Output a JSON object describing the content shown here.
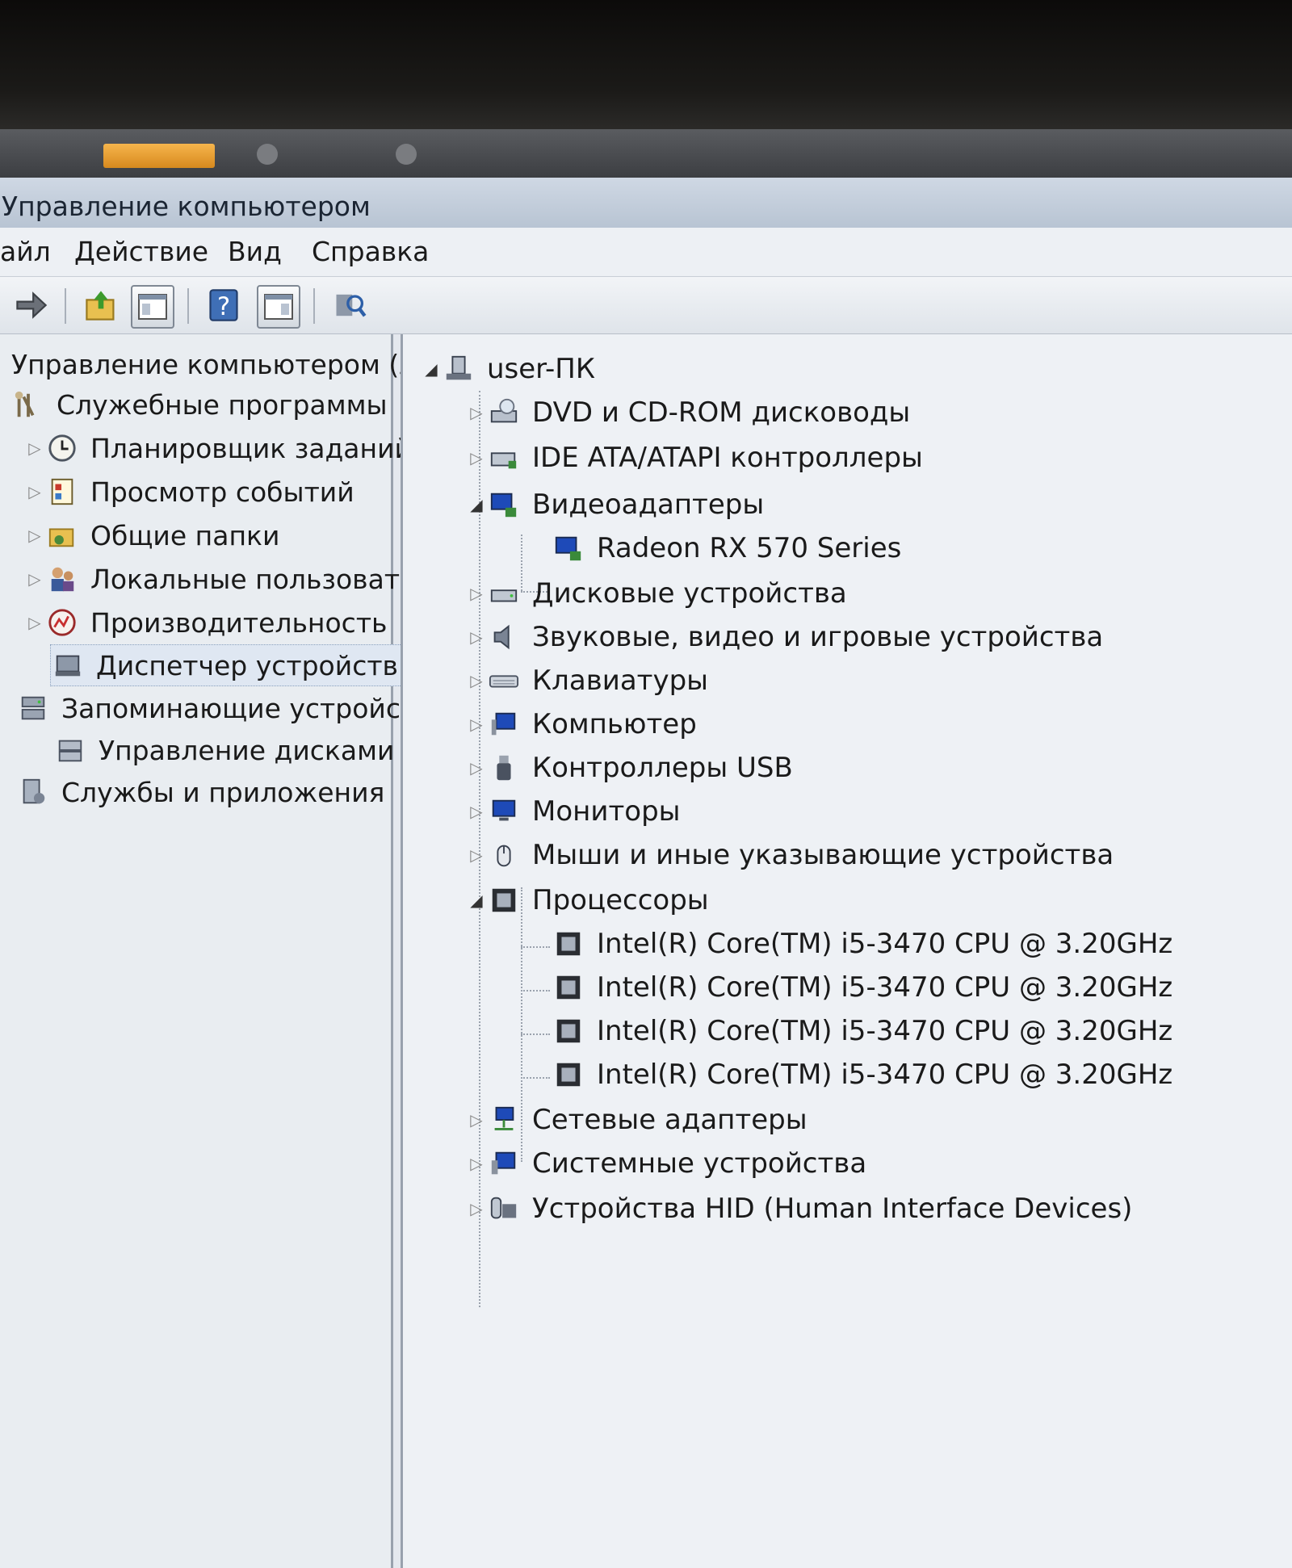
{
  "window": {
    "title": "Управление компьютером"
  },
  "menu": [
    "айл",
    "Действие",
    "Вид",
    "Справка"
  ],
  "toolbar": {
    "icons": [
      "forward-arrow-icon",
      "up-folder-icon",
      "show-hide-tree-icon",
      "help-icon",
      "action-pane-icon",
      "scan-hardware-icon"
    ]
  },
  "left_tree": [
    {
      "label": "Управление компьютером (л",
      "icon": "computer-management-icon"
    },
    {
      "label": "Служебные программы",
      "icon": "tools-icon"
    },
    {
      "label": "Планировщик заданий",
      "icon": "clock-icon"
    },
    {
      "label": "Просмотр событий",
      "icon": "event-viewer-icon"
    },
    {
      "label": "Общие папки",
      "icon": "shared-folders-icon"
    },
    {
      "label": "Локальные пользовате",
      "icon": "users-icon"
    },
    {
      "label": "Производительность",
      "icon": "performance-icon"
    },
    {
      "label": "Диспетчер устройств",
      "icon": "device-manager-icon"
    },
    {
      "label": "Запоминающие устройст",
      "icon": "storage-icon"
    },
    {
      "label": "Управление дисками",
      "icon": "disk-management-icon"
    },
    {
      "label": "Службы и приложения",
      "icon": "services-icon"
    }
  ],
  "device_tree": {
    "root": "user-ПК",
    "categories": [
      {
        "label": "DVD и CD-ROM дисководы",
        "icon": "dvd-drive-icon"
      },
      {
        "label": "IDE ATA/ATAPI контроллеры",
        "icon": "ide-controller-icon"
      },
      {
        "label": "Видеоадаптеры",
        "icon": "display-adapter-icon",
        "children": [
          "Radeon RX 570 Series"
        ]
      },
      {
        "label": "Дисковые устройства",
        "icon": "disk-drive-icon"
      },
      {
        "label": "Звуковые, видео и игровые устройства",
        "icon": "speaker-icon"
      },
      {
        "label": "Клавиатуры",
        "icon": "keyboard-icon"
      },
      {
        "label": "Компьютер",
        "icon": "computer-icon"
      },
      {
        "label": "Контроллеры USB",
        "icon": "usb-icon"
      },
      {
        "label": "Мониторы",
        "icon": "monitor-icon"
      },
      {
        "label": "Мыши и иные указывающие устройства",
        "icon": "mouse-icon"
      },
      {
        "label": "Процессоры",
        "icon": "processor-icon",
        "children": [
          "Intel(R) Core(TM) i5-3470 CPU @ 3.20GHz",
          "Intel(R) Core(TM) i5-3470 CPU @ 3.20GHz",
          "Intel(R) Core(TM) i5-3470 CPU @ 3.20GHz",
          "Intel(R) Core(TM) i5-3470 CPU @ 3.20GHz"
        ]
      },
      {
        "label": "Сетевые адаптеры",
        "icon": "network-adapter-icon"
      },
      {
        "label": "Системные устройства",
        "icon": "system-devices-icon"
      },
      {
        "label": "Устройства HID (Human Interface Devices)",
        "icon": "hid-icon"
      }
    ]
  }
}
